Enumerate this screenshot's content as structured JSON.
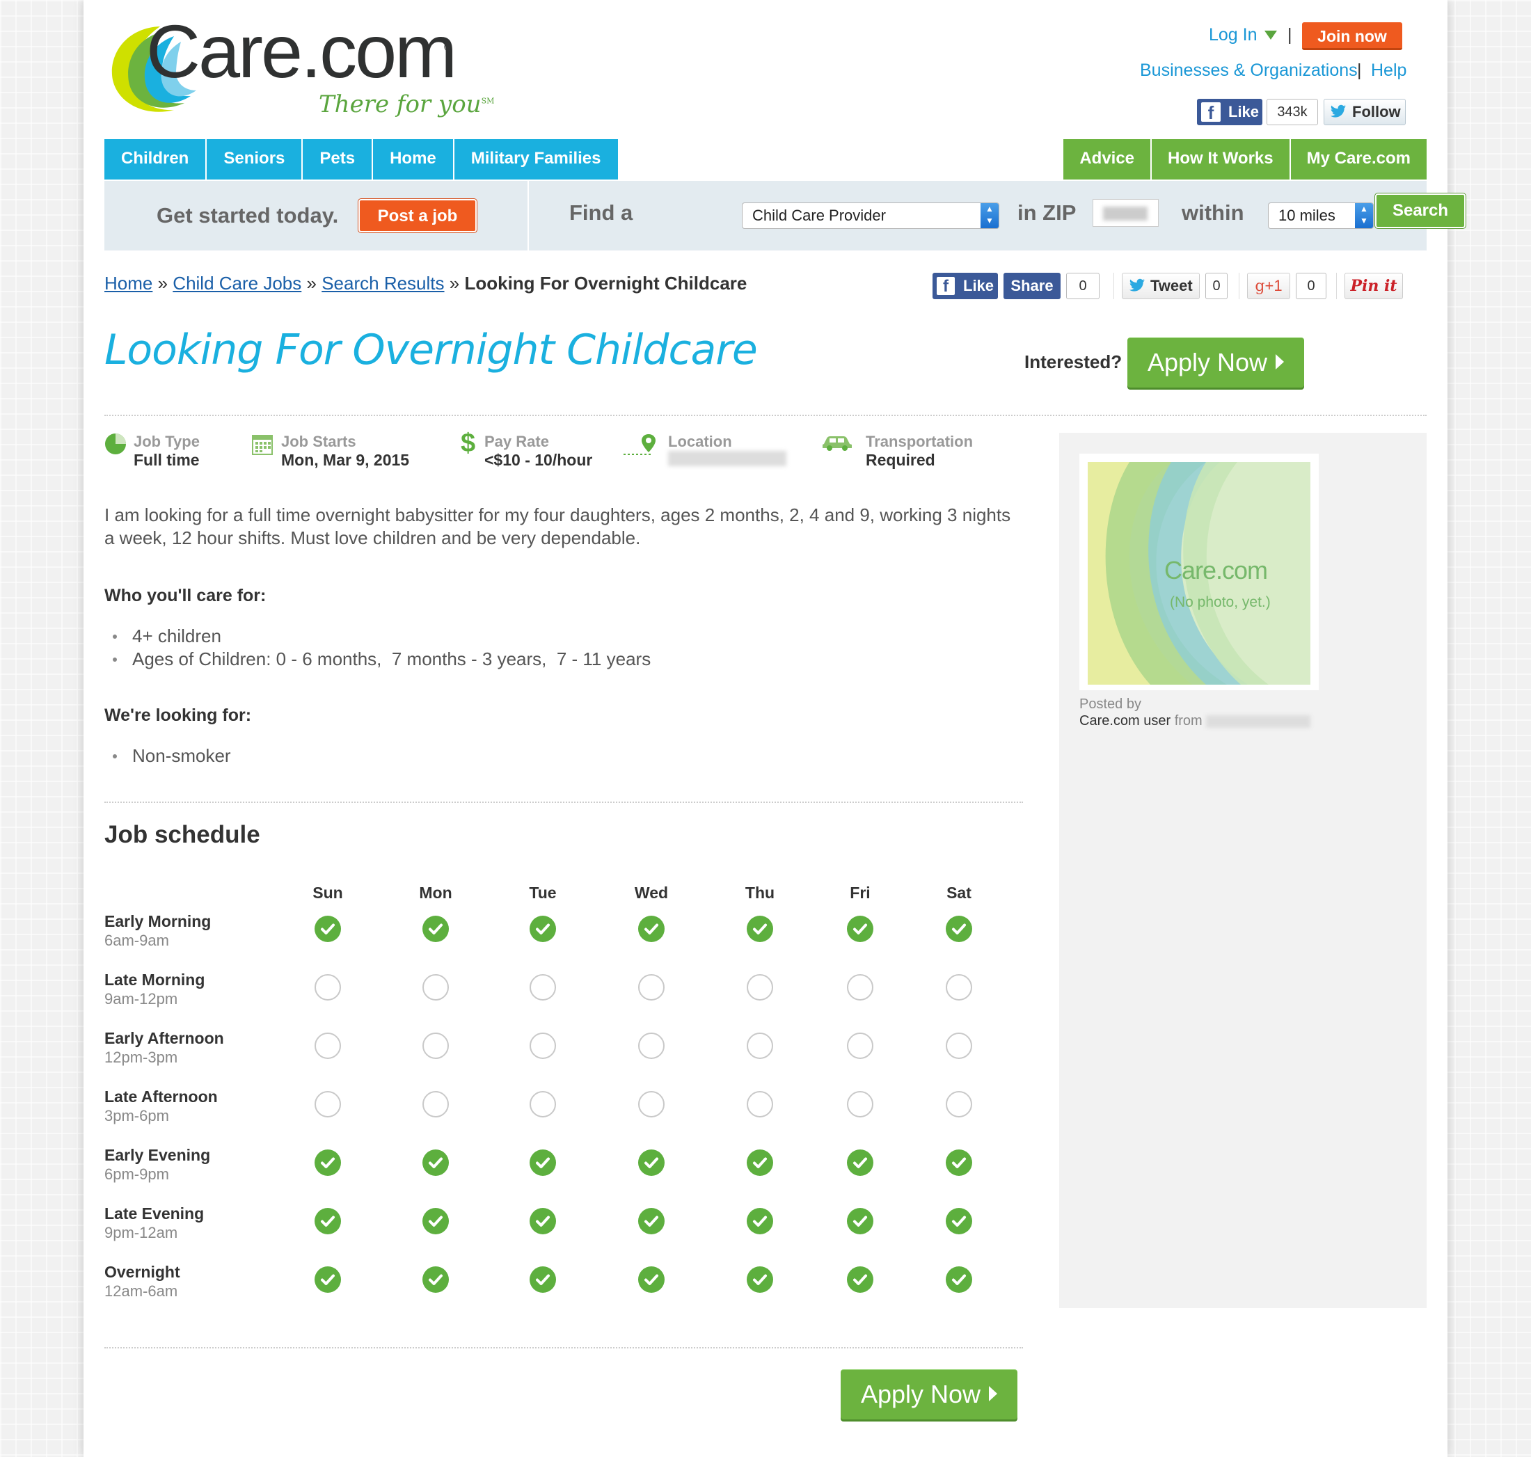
{
  "brand": {
    "name": "Care.com",
    "registered": "®",
    "tagline": "There for you",
    "tagline_mark": "SM"
  },
  "header": {
    "login": "Log In",
    "pipe": "|",
    "join": "Join now",
    "businesses": "Businesses & Organizations",
    "help": "Help",
    "fb_like": "Like",
    "fb_count": "343k",
    "follow": "Follow"
  },
  "nav": {
    "left": [
      "Children",
      "Seniors",
      "Pets",
      "Home",
      "Military Families"
    ],
    "right": [
      "Advice",
      "How It Works",
      "My Care.com"
    ]
  },
  "search": {
    "get_started": "Get started today.",
    "post_job": "Post a job",
    "find_a": "Find a",
    "provider_value": "Child Care Provider",
    "in_zip": "in ZIP",
    "zip_value": "",
    "within": "within",
    "distance_value": "10 miles",
    "search_btn": "Search"
  },
  "breadcrumb": {
    "items": [
      "Home",
      "Child Care Jobs",
      "Search Results"
    ],
    "current": "Looking For Overnight Childcare",
    "sep": "»"
  },
  "share": {
    "like": "Like",
    "share": "Share",
    "share_count": "0",
    "tweet": "Tweet",
    "tweet_count": "0",
    "gplus": "+1",
    "gplus_count": "0",
    "pin": "Pin it"
  },
  "job": {
    "title": "Looking For Overnight Childcare",
    "interested": "Interested?",
    "apply": "Apply Now",
    "facts": [
      {
        "label": "Job Type",
        "value": "Full time",
        "icon": "pie-icon"
      },
      {
        "label": "Job Starts",
        "value": "Mon, Mar 9, 2015",
        "icon": "calendar-icon"
      },
      {
        "label": "Pay Rate",
        "value": "<$10 - 10/hour",
        "icon": "dollar-icon"
      },
      {
        "label": "Location",
        "value": "",
        "icon": "map-pin-icon"
      },
      {
        "label": "Transportation",
        "value": "Required",
        "icon": "car-icon"
      }
    ],
    "description": "I am looking for a full time overnight babysitter for my four daughters, ages 2 months, 2, 4 and 9, working 3 nights a week, 12 hour shifts. Must love children and be very dependable.",
    "care_for_heading": "Who you'll care for:",
    "care_for": [
      "4+ children",
      "Ages of Children: 0 - 6 months,  7 months - 3 years,  7 - 11 years"
    ],
    "looking_for_heading": "We're looking for:",
    "looking_for": [
      "Non-smoker"
    ]
  },
  "schedule": {
    "title": "Job schedule",
    "days": [
      "Sun",
      "Mon",
      "Tue",
      "Wed",
      "Thu",
      "Fri",
      "Sat"
    ],
    "slots": [
      {
        "name": "Early Morning",
        "time": "6am-9am",
        "checked": [
          true,
          true,
          true,
          true,
          true,
          true,
          true
        ]
      },
      {
        "name": "Late Morning",
        "time": "9am-12pm",
        "checked": [
          false,
          false,
          false,
          false,
          false,
          false,
          false
        ]
      },
      {
        "name": "Early Afternoon",
        "time": "12pm-3pm",
        "checked": [
          false,
          false,
          false,
          false,
          false,
          false,
          false
        ]
      },
      {
        "name": "Late Afternoon",
        "time": "3pm-6pm",
        "checked": [
          false,
          false,
          false,
          false,
          false,
          false,
          false
        ]
      },
      {
        "name": "Early Evening",
        "time": "6pm-9pm",
        "checked": [
          true,
          true,
          true,
          true,
          true,
          true,
          true
        ]
      },
      {
        "name": "Late Evening",
        "time": "9pm-12am",
        "checked": [
          true,
          true,
          true,
          true,
          true,
          true,
          true
        ]
      },
      {
        "name": "Overnight",
        "time": "12am-6am",
        "checked": [
          true,
          true,
          true,
          true,
          true,
          true,
          true
        ]
      }
    ]
  },
  "sidebar": {
    "photo_brand": "Care.com",
    "photo_note": "(No photo, yet.)",
    "posted_by": "Posted by",
    "user": "Care.com user",
    "from": "from"
  },
  "colors": {
    "blue": "#1ab0df",
    "green": "#6cb33f",
    "orange": "#ef5a1f",
    "facebook": "#3b5998"
  }
}
